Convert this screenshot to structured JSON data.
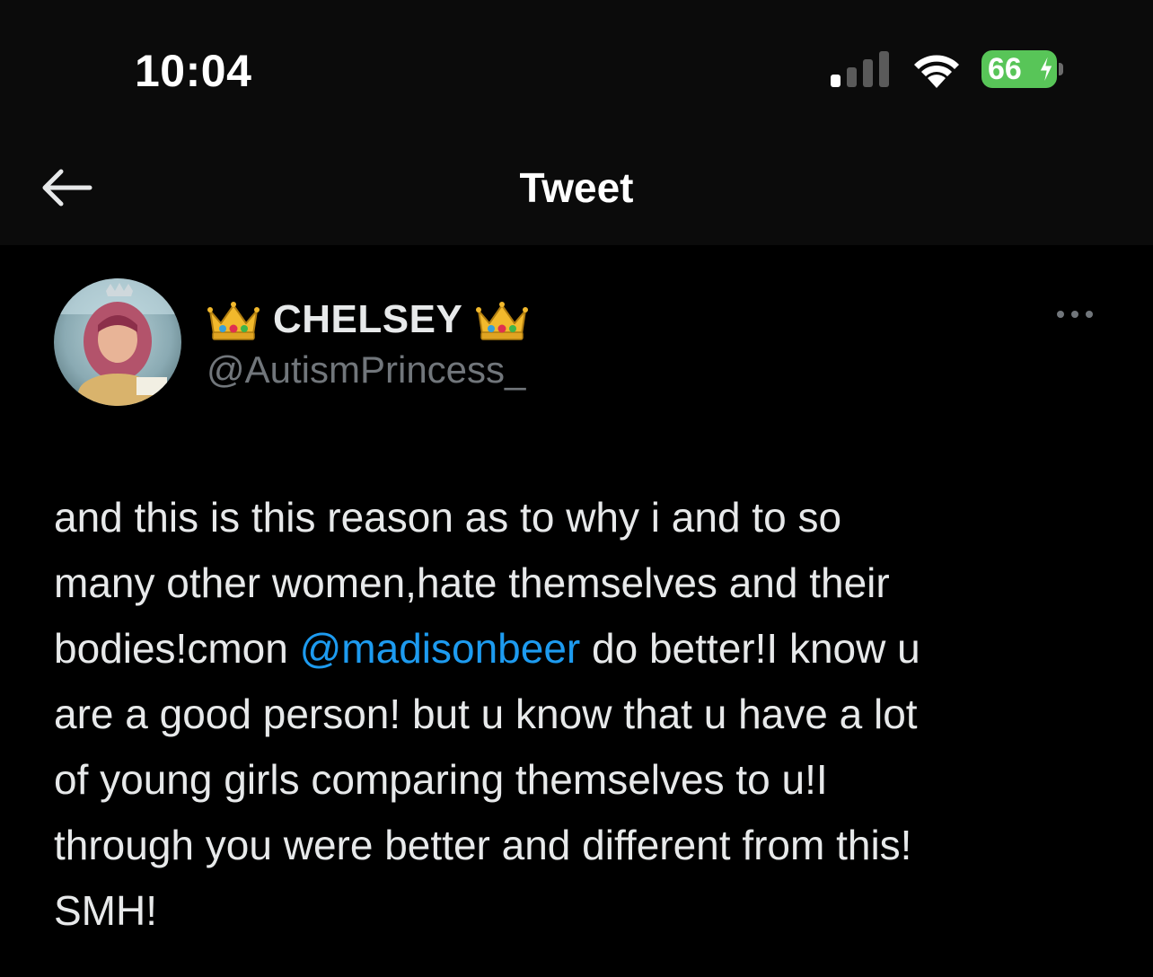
{
  "status_bar": {
    "time": "10:04",
    "battery": "66",
    "battery_color": "#58c558",
    "icons": [
      "cellular-signal-icon",
      "wifi-icon",
      "battery-charging-icon"
    ]
  },
  "header": {
    "title": "Tweet",
    "back_icon": "back-arrow-icon"
  },
  "tweet": {
    "author": {
      "display_name": "CHELSEY",
      "name_emoji": "crown-icon",
      "handle": "@AutismPrincess_"
    },
    "more_icon": "more-options-icon",
    "body": {
      "line1": "and this is this reason as to why i and to so",
      "line2": "many other women,hate themselves and their",
      "line3_pre": "bodies!cmon ",
      "mention": "@madisonbeer",
      "line3_post": " do better!I know u",
      "line4": "are a good person! but u know that u have a lot",
      "line5": "of young girls comparing themselves to u!I",
      "line6": "through you were better and different from this!",
      "line7": "SMH!"
    },
    "mention_color": "#1d9bf0"
  }
}
